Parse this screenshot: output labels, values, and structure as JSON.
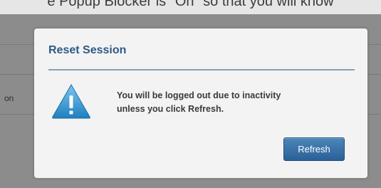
{
  "background": {
    "top_strip_text": "e Popup Blocker is \"On\" so that you will know",
    "fragment_text": "on"
  },
  "dialog": {
    "title": "Reset Session",
    "message_line1": "You will be logged out due to inactivity",
    "message_line2": "unless you click Refresh.",
    "refresh_label": "Refresh",
    "icon": "warning-icon",
    "accent_color": "#2c5a86",
    "button_color": "#3a74ab"
  }
}
